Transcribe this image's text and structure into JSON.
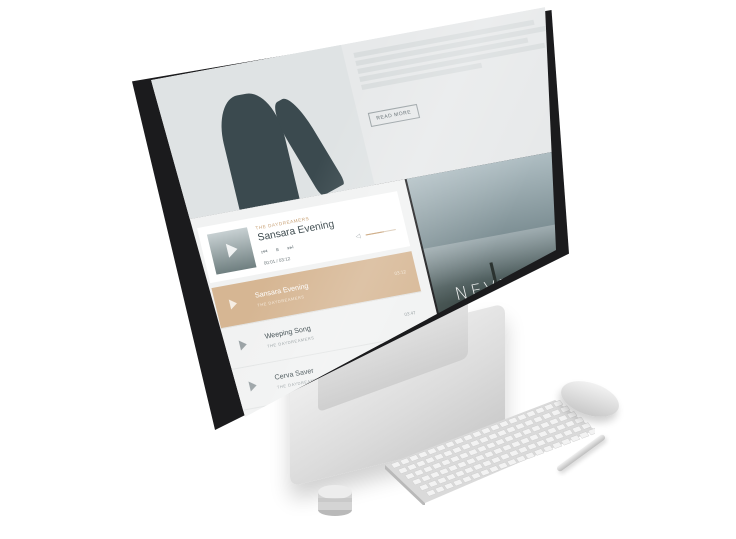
{
  "hero": {
    "read_more_label": "READ MORE"
  },
  "now_playing": {
    "artist": "THE DAYDREAMERS",
    "title": "Sansara Evening",
    "controls": "⏮ ⏸ ⏭",
    "time": "00:01 / 03:12",
    "volume_level": 0.6
  },
  "tracks": [
    {
      "name": "Sansara Evening",
      "artist": "THE DAYDREAMERS",
      "duration": "03:12",
      "active": true
    },
    {
      "name": "Weeping Song",
      "artist": "THE DAYDREAMERS",
      "duration": "03:47",
      "active": false
    },
    {
      "name": "Cerva Saver",
      "artist": "THE DAYDREAMERS",
      "duration": "02:56",
      "active": false
    }
  ],
  "album": {
    "title": "NEVERMORE",
    "subtitle": "THE DAYDREAMERS"
  },
  "colors": {
    "accent": "#d6b693",
    "dark": "#3b4a4f",
    "panel": "#f1f2f2"
  }
}
